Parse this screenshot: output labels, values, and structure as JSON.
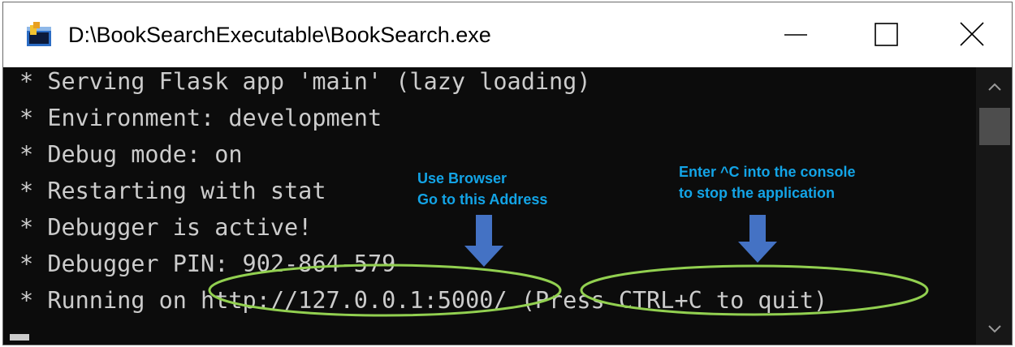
{
  "window": {
    "title": "D:\\BookSearchExecutable\\BookSearch.exe",
    "icon": "console-app-icon",
    "controls": [
      "minimize-icon",
      "maximize-icon",
      "close-icon"
    ]
  },
  "console": {
    "lines": [
      "* Serving Flask app 'main' (lazy loading)",
      "* Environment: development",
      "* Debug mode: on",
      "* Restarting with stat",
      "* Debugger is active!",
      "* Debugger PIN: 902-864-579",
      "* Running on http://127.0.0.1:5000/ (Press CTRL+C to quit)"
    ]
  },
  "annotations": {
    "browser_line1": "Use Browser",
    "browser_line2": "Go to this Address",
    "stop_line1": "Enter ^C into the console",
    "stop_line2": "to stop the application"
  },
  "colors": {
    "console_bg": "#0c0c0c",
    "console_text": "#cccccc",
    "annotation_text": "#13a4e6",
    "arrow": "#4472c4",
    "highlight_ellipse": "#92d050"
  }
}
